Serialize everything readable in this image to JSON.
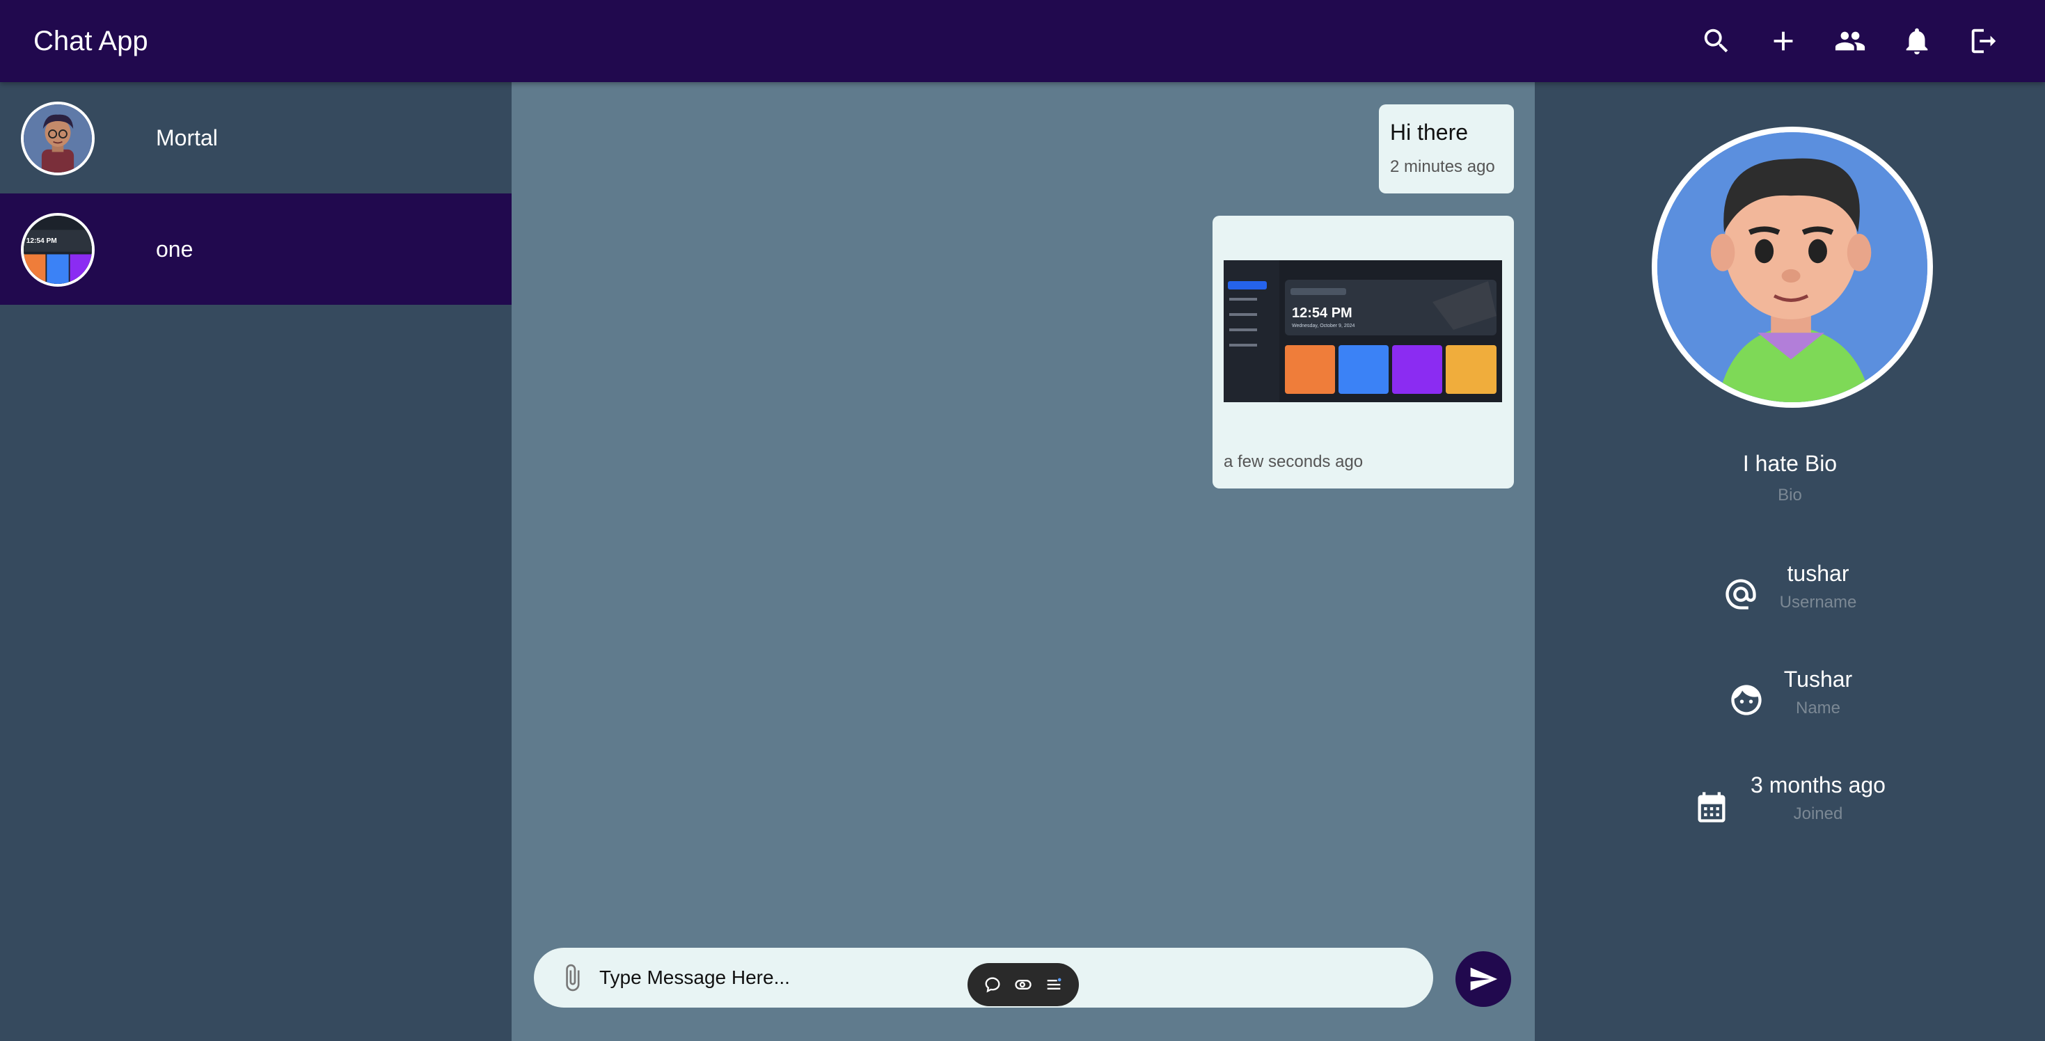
{
  "header": {
    "title": "Chat App",
    "actions": [
      "search-icon",
      "add-icon",
      "group-icon",
      "notifications-icon",
      "logout-icon"
    ]
  },
  "sidebar": {
    "contacts": [
      {
        "name": "Mortal",
        "avatar": "cartoon-avatar",
        "active": false
      },
      {
        "name": "one",
        "avatar": "screenshot-thumbnail",
        "active": true
      }
    ]
  },
  "chat": {
    "messages": [
      {
        "text": "Hi there",
        "time": "2 minutes ago"
      },
      {
        "image": "dashboard-screenshot",
        "time": "a few seconds ago",
        "image_content": {
          "clock": "12:54 PM",
          "date": "Wednesday, October 9, 2024"
        }
      }
    ],
    "composer": {
      "placeholder": "Type Message Here..."
    }
  },
  "profile": {
    "bio": "I hate Bio",
    "bio_label": "Bio",
    "username": "tushar",
    "username_label": "Username",
    "name": "Tushar",
    "name_label": "Name",
    "joined": "3 months ago",
    "joined_label": "Joined"
  },
  "colors": {
    "appbar": "#21094e",
    "sidebar": "#364a5e",
    "chat_bg": "#607b8d",
    "bubble": "#e8f4f4",
    "active_contact": "#21094e"
  }
}
